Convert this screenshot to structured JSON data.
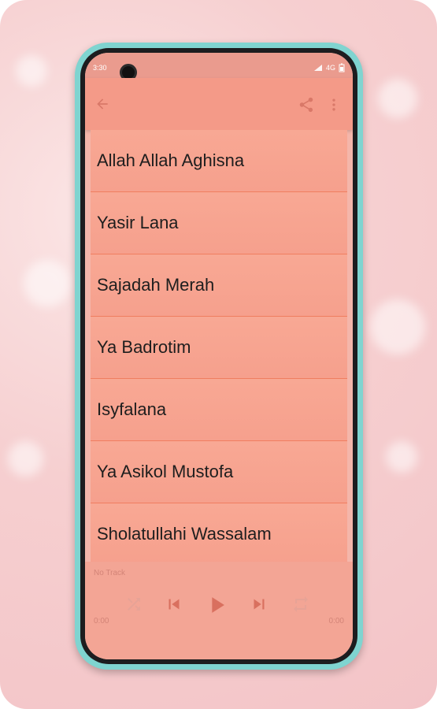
{
  "status_bar": {
    "time": "3:30",
    "network": "4G"
  },
  "toolbar": {
    "back_icon": "arrow-left-icon",
    "share_icon": "share-icon",
    "menu_icon": "more-vert-icon"
  },
  "songs": [
    {
      "title": "Allah Allah Aghisna"
    },
    {
      "title": "Yasir Lana"
    },
    {
      "title": "Sajadah Merah"
    },
    {
      "title": "Ya Badrotim"
    },
    {
      "title": "Isyfalana"
    },
    {
      "title": "Ya Asikol Mustofa"
    },
    {
      "title": "Sholatullahi Wassalam"
    }
  ],
  "player": {
    "track_label": "No Track",
    "elapsed": "0:00",
    "duration": "0:00",
    "shuffle_icon": "shuffle-icon",
    "prev_icon": "skip-previous-icon",
    "play_icon": "play-icon",
    "next_icon": "skip-next-icon",
    "repeat_icon": "repeat-icon"
  },
  "colors": {
    "accent": "#f49a88",
    "frame": "#7fd4d0",
    "divider": "#f07e60"
  }
}
